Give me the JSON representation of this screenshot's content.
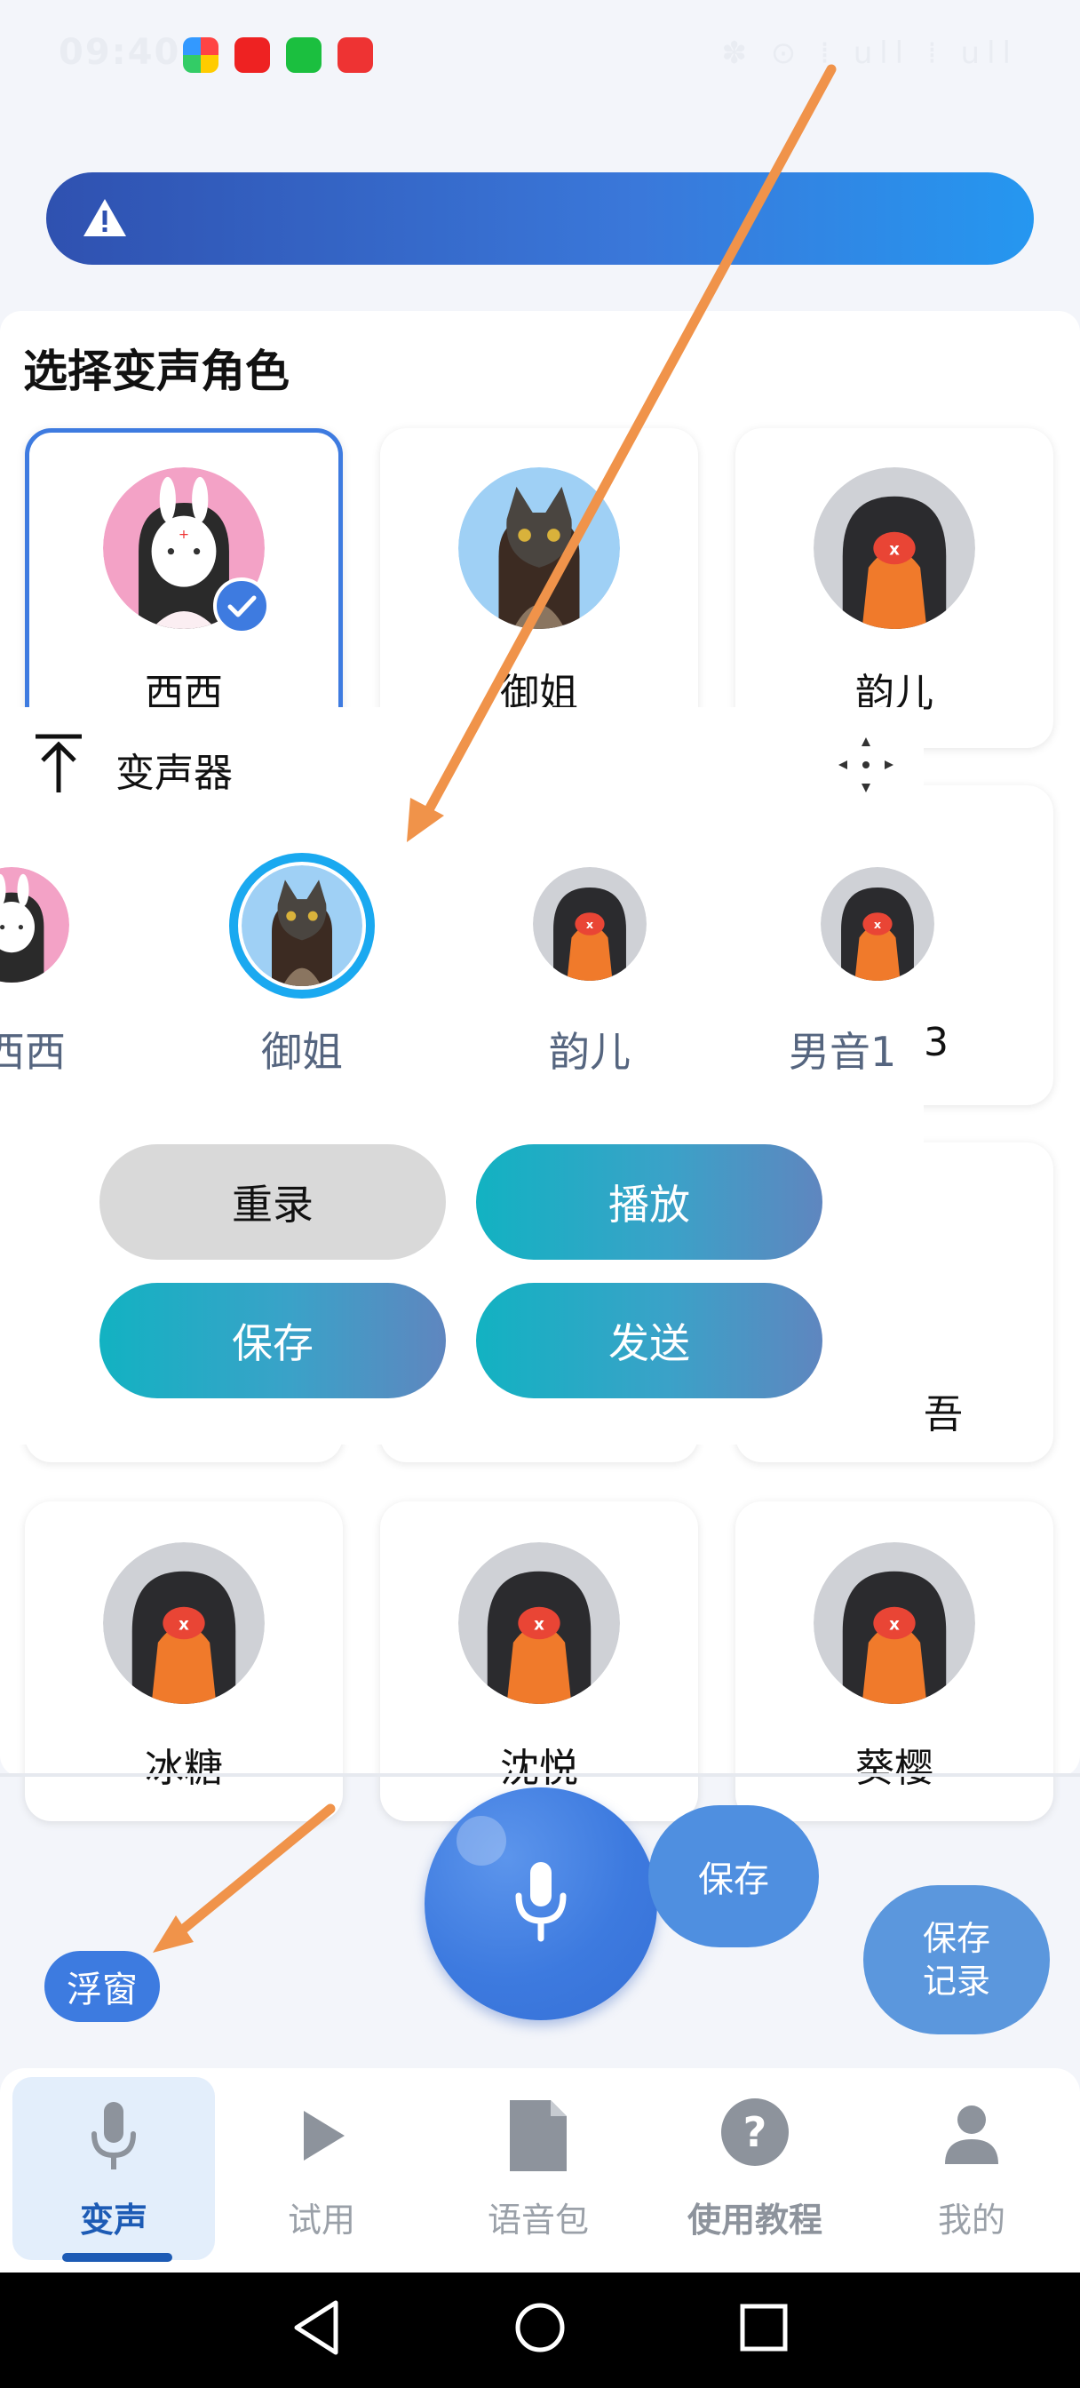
{
  "status_bar": {
    "time": "09:40",
    "right_text": "✽ ⊙ ⁞ ull ⁞ ull"
  },
  "banner": {
    "icon": "warning-icon",
    "text": ""
  },
  "voice_card": {
    "title": "选择变声角色",
    "roles": [
      {
        "name": "西西",
        "avatar": "bunny-mask-girl",
        "selected": true
      },
      {
        "name": "御姐",
        "avatar": "cat-mask-girl",
        "selected": false
      },
      {
        "name": "韵儿",
        "avatar": "hooded-figure",
        "selected": false
      },
      {
        "name": "冰糖",
        "avatar": "hooded-figure",
        "selected": false
      },
      {
        "name": "沈悦",
        "avatar": "hooded-figure",
        "selected": false
      },
      {
        "name": "葵樱",
        "avatar": "hooded-figure",
        "selected": false
      }
    ],
    "partial_text_right": "3",
    "partial_text_right2": "吾"
  },
  "float_widget": {
    "title": "变声器",
    "voices": [
      {
        "name": "西西"
      },
      {
        "name": "御姐",
        "active": true
      },
      {
        "name": "韵儿"
      },
      {
        "name": "男音1"
      }
    ],
    "buttons": {
      "rerecord": "重录",
      "play": "播放",
      "save": "保存",
      "send": "发送"
    }
  },
  "controls": {
    "mic_icon": "microphone-icon",
    "save": "保存",
    "save_record_line1": "保存",
    "save_record_line2": "记录",
    "float_window": "浮窗"
  },
  "tabs": [
    {
      "label": "变声",
      "icon": "microphone-icon",
      "active": true
    },
    {
      "label": "试用",
      "icon": "play-icon",
      "active": false
    },
    {
      "label": "语音包",
      "icon": "file-icon",
      "active": false
    },
    {
      "label": "使用教程",
      "icon": "help-icon",
      "active": false
    },
    {
      "label": "我的",
      "icon": "person-icon",
      "active": false
    }
  ],
  "colors": {
    "accent": "#3e7be0",
    "annotation_arrow": "#f0934a",
    "tab_active": "#1d5bb5"
  }
}
